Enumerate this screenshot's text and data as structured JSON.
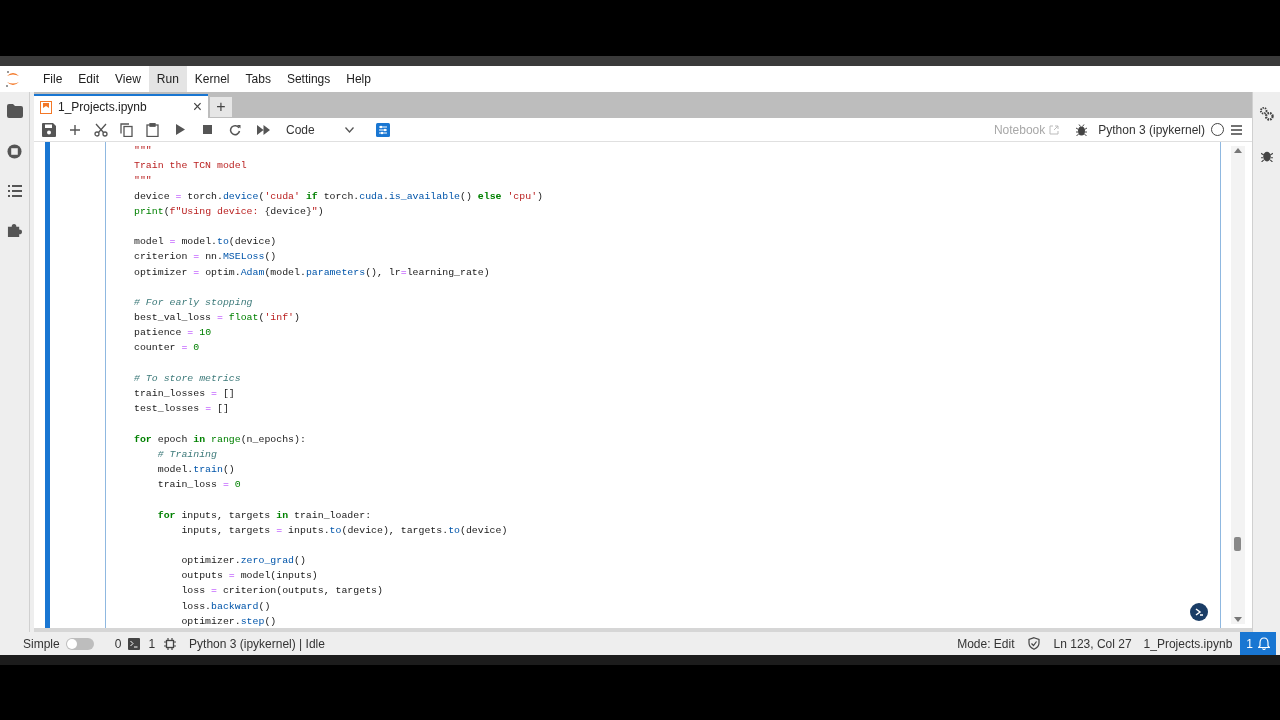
{
  "menu": [
    {
      "label": "File",
      "selected": false
    },
    {
      "label": "Edit",
      "selected": false
    },
    {
      "label": "View",
      "selected": false
    },
    {
      "label": "Run",
      "selected": true
    },
    {
      "label": "Kernel",
      "selected": false
    },
    {
      "label": "Tabs",
      "selected": false
    },
    {
      "label": "Settings",
      "selected": false
    },
    {
      "label": "Help",
      "selected": false
    }
  ],
  "tabs": [
    {
      "label": "1_Projects.ipynb",
      "selected": true,
      "close": "×"
    }
  ],
  "new_tab": "+",
  "toolbar": {
    "cell_type": "Code",
    "notebook_label": "Notebook",
    "kernel": "Python 3 (ipykernel)"
  },
  "code_blocks": [
    [
      [
        {
          "text": "\"\"\"",
          "kind": "str"
        }
      ],
      [
        {
          "text": "Train the TCN model",
          "kind": "str"
        }
      ],
      [
        {
          "text": "\"\"\"",
          "kind": "str"
        }
      ],
      [
        {
          "text": "device ",
          "kind": "plain"
        },
        {
          "text": "=",
          "kind": "op"
        },
        {
          "text": " torch.",
          "kind": "plain"
        },
        {
          "text": "device",
          "kind": "method"
        },
        {
          "text": "(",
          "kind": "plain"
        },
        {
          "text": "'cuda'",
          "kind": "str"
        },
        {
          "text": " if",
          "kind": "kw"
        },
        {
          "text": " torch.",
          "kind": "plain"
        },
        {
          "text": "cuda",
          "kind": "method"
        },
        {
          "text": ".",
          "kind": "plain"
        },
        {
          "text": "is_available",
          "kind": "method"
        },
        {
          "text": "() ",
          "kind": "plain"
        },
        {
          "text": "else",
          "kind": "kw"
        },
        {
          "text": " 'cpu'",
          "kind": "str"
        },
        {
          "text": ")",
          "kind": "plain"
        }
      ],
      [
        {
          "text": "print",
          "kind": "builtin"
        },
        {
          "text": "(",
          "kind": "plain"
        },
        {
          "text": "f\"Using device: ",
          "kind": "str"
        },
        {
          "text": "{device}",
          "kind": "plain"
        },
        {
          "text": "\"",
          "kind": "str"
        },
        {
          "text": ")",
          "kind": "plain"
        }
      ]
    ],
    [
      [
        {
          "text": "model ",
          "kind": "plain"
        },
        {
          "text": "=",
          "kind": "op"
        },
        {
          "text": " model.",
          "kind": "plain"
        },
        {
          "text": "to",
          "kind": "method"
        },
        {
          "text": "(device)",
          "kind": "plain"
        }
      ],
      [
        {
          "text": "criterion ",
          "kind": "plain"
        },
        {
          "text": "=",
          "kind": "op"
        },
        {
          "text": " nn.",
          "kind": "plain"
        },
        {
          "text": "MSELoss",
          "kind": "method"
        },
        {
          "text": "()",
          "kind": "plain"
        }
      ],
      [
        {
          "text": "optimizer ",
          "kind": "plain"
        },
        {
          "text": "=",
          "kind": "op"
        },
        {
          "text": " optim.",
          "kind": "plain"
        },
        {
          "text": "Adam",
          "kind": "method"
        },
        {
          "text": "(model.",
          "kind": "plain"
        },
        {
          "text": "parameters",
          "kind": "method"
        },
        {
          "text": "(), lr",
          "kind": "plain"
        },
        {
          "text": "=",
          "kind": "op"
        },
        {
          "text": "learning_rate)",
          "kind": "plain"
        }
      ]
    ],
    [
      [
        {
          "text": "# For early stopping",
          "kind": "comment"
        }
      ],
      [
        {
          "text": "best_val_loss ",
          "kind": "plain"
        },
        {
          "text": "=",
          "kind": "op"
        },
        {
          "text": " float",
          "kind": "builtin"
        },
        {
          "text": "(",
          "kind": "plain"
        },
        {
          "text": "'inf'",
          "kind": "str"
        },
        {
          "text": ")",
          "kind": "plain"
        }
      ],
      [
        {
          "text": "patience ",
          "kind": "plain"
        },
        {
          "text": "=",
          "kind": "op"
        },
        {
          "text": " 10",
          "kind": "num"
        }
      ],
      [
        {
          "text": "counter ",
          "kind": "plain"
        },
        {
          "text": "=",
          "kind": "op"
        },
        {
          "text": " 0",
          "kind": "num"
        }
      ]
    ],
    [
      [
        {
          "text": "# To store metrics",
          "kind": "comment"
        }
      ],
      [
        {
          "text": "train_losses ",
          "kind": "plain"
        },
        {
          "text": "=",
          "kind": "op"
        },
        {
          "text": " []",
          "kind": "plain"
        }
      ],
      [
        {
          "text": "test_losses ",
          "kind": "plain"
        },
        {
          "text": "=",
          "kind": "op"
        },
        {
          "text": " []",
          "kind": "plain"
        }
      ]
    ],
    [
      [
        {
          "text": "for",
          "kind": "kw"
        },
        {
          "text": " epoch ",
          "kind": "plain"
        },
        {
          "text": "in",
          "kind": "kw"
        },
        {
          "text": " range",
          "kind": "builtin"
        },
        {
          "text": "(n_epochs):",
          "kind": "plain"
        }
      ],
      [
        {
          "text": "    # Training",
          "kind": "comment"
        }
      ],
      [
        {
          "text": "    model.",
          "kind": "plain"
        },
        {
          "text": "train",
          "kind": "method"
        },
        {
          "text": "()",
          "kind": "plain"
        }
      ],
      [
        {
          "text": "    train_loss ",
          "kind": "plain"
        },
        {
          "text": "=",
          "kind": "op"
        },
        {
          "text": " 0",
          "kind": "num"
        }
      ]
    ],
    [
      [
        {
          "text": "    for",
          "kind": "kw"
        },
        {
          "text": " inputs, targets ",
          "kind": "plain"
        },
        {
          "text": "in",
          "kind": "kw"
        },
        {
          "text": " train_loader:",
          "kind": "plain"
        }
      ],
      [
        {
          "text": "        inputs, targets ",
          "kind": "plain"
        },
        {
          "text": "=",
          "kind": "op"
        },
        {
          "text": " inputs.",
          "kind": "plain"
        },
        {
          "text": "to",
          "kind": "method"
        },
        {
          "text": "(device), targets.",
          "kind": "plain"
        },
        {
          "text": "to",
          "kind": "method"
        },
        {
          "text": "(device)",
          "kind": "plain"
        }
      ]
    ],
    [
      [
        {
          "text": "        optimizer.",
          "kind": "plain"
        },
        {
          "text": "zero_grad",
          "kind": "method"
        },
        {
          "text": "()",
          "kind": "plain"
        }
      ],
      [
        {
          "text": "        outputs ",
          "kind": "plain"
        },
        {
          "text": "=",
          "kind": "op"
        },
        {
          "text": " model(inputs)",
          "kind": "plain"
        }
      ],
      [
        {
          "text": "        loss ",
          "kind": "plain"
        },
        {
          "text": "=",
          "kind": "op"
        },
        {
          "text": " criterion(outputs, targets)",
          "kind": "plain"
        }
      ],
      [
        {
          "text": "        loss.",
          "kind": "plain"
        },
        {
          "text": "backward",
          "kind": "method"
        },
        {
          "text": "()",
          "kind": "plain"
        }
      ],
      [
        {
          "text": "        optimizer.",
          "kind": "plain"
        },
        {
          "text": "step",
          "kind": "method"
        },
        {
          "text": "()",
          "kind": "plain"
        }
      ]
    ]
  ],
  "status_bar": {
    "mode_label": "Simple",
    "simple_on": false,
    "terminals": "0",
    "kernels": "1",
    "kernel_status": "Python 3 (ipykernel) | Idle",
    "mode": "Mode: Edit",
    "cursor": "Ln 123, Col 27",
    "file": "1_Projects.ipynb",
    "notifications": "1"
  }
}
